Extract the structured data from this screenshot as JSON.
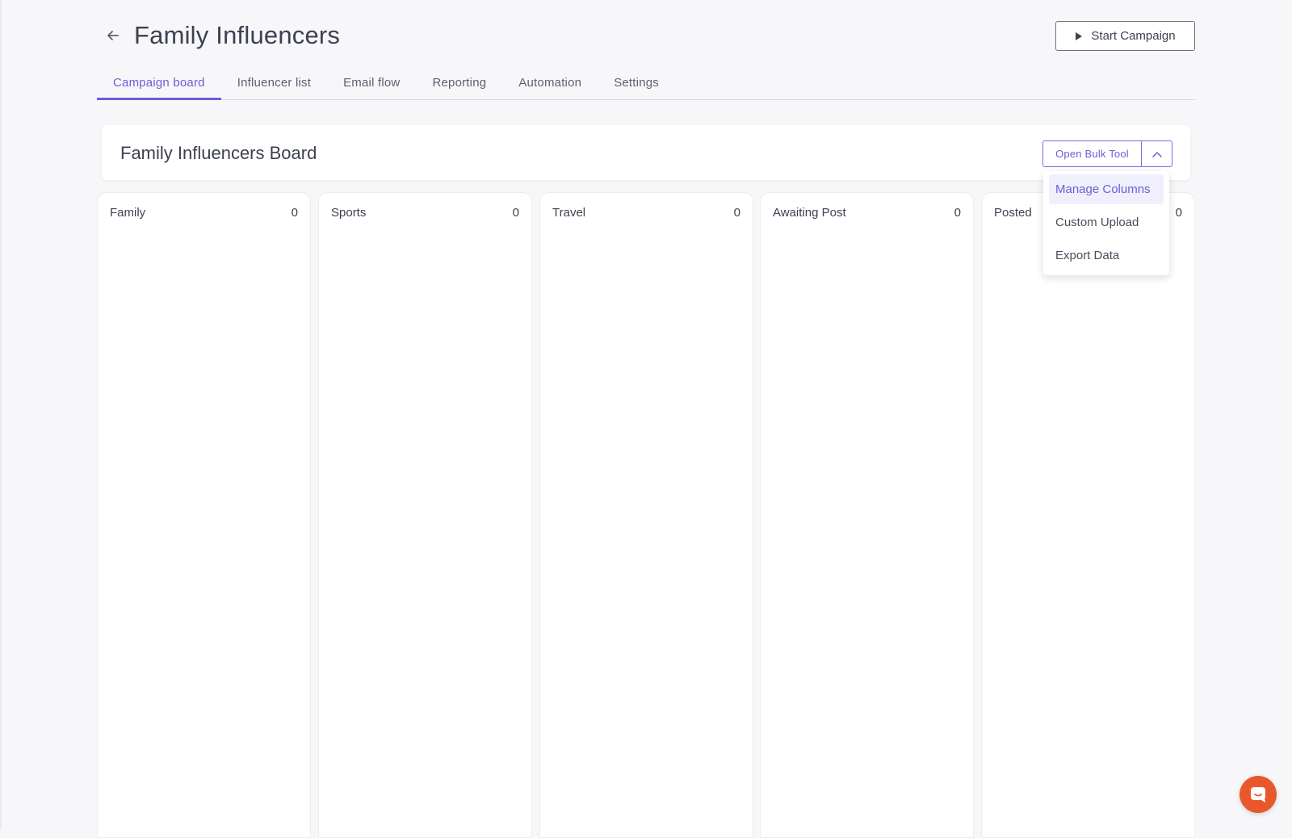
{
  "header": {
    "title": "Family Influencers",
    "start_button": "Start Campaign"
  },
  "tabs": [
    {
      "label": "Campaign board",
      "active": true
    },
    {
      "label": "Influencer list",
      "active": false
    },
    {
      "label": "Email flow",
      "active": false
    },
    {
      "label": "Reporting",
      "active": false
    },
    {
      "label": "Automation",
      "active": false
    },
    {
      "label": "Settings",
      "active": false
    }
  ],
  "board": {
    "title": "Family Influencers Board",
    "bulk_button": "Open Bulk Tool"
  },
  "columns": [
    {
      "name": "Family",
      "count": "0"
    },
    {
      "name": "Sports",
      "count": "0"
    },
    {
      "name": "Travel",
      "count": "0"
    },
    {
      "name": "Awaiting Post",
      "count": "0"
    },
    {
      "name": "Posted",
      "count": "0"
    }
  ],
  "dropdown": {
    "items": [
      {
        "label": "Manage Columns",
        "active": true
      },
      {
        "label": "Custom Upload",
        "active": false
      },
      {
        "label": "Export Data",
        "active": false
      }
    ]
  },
  "colors": {
    "accent": "#6d5ed6",
    "chat": "#e8582a"
  },
  "icons": {
    "back": "arrow-left-icon",
    "start": "play-icon",
    "toggle": "chevron-up-icon",
    "chat": "chat-icon"
  }
}
